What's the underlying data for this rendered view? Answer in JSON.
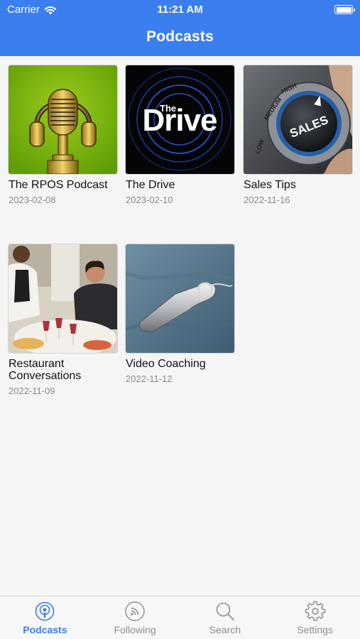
{
  "status_bar": {
    "carrier": "Carrier",
    "time": "11:21 AM"
  },
  "nav": {
    "title": "Podcasts"
  },
  "podcasts": [
    {
      "title": "The RPOS Podcast",
      "date": "2023-02-08"
    },
    {
      "title": "The Drive",
      "date": "2023-02-10"
    },
    {
      "title": "Sales Tips",
      "date": "2022-11-16"
    },
    {
      "title": "Restaurant\nConversations",
      "date": "2022-11-09"
    },
    {
      "title": "Video Coaching",
      "date": "2022-11-12"
    }
  ],
  "artwork_text": {
    "drive_small": "The",
    "drive_big": "Drive",
    "knob_word": "SALES",
    "knob_scale": [
      "LOW",
      "MEDIUM",
      "HIGH"
    ]
  },
  "tabs": [
    {
      "label": "Podcasts",
      "icon": "podcast-icon",
      "active": true
    },
    {
      "label": "Following",
      "icon": "feed-icon",
      "active": false
    },
    {
      "label": "Search",
      "icon": "search-icon",
      "active": false
    },
    {
      "label": "Settings",
      "icon": "gear-icon",
      "active": false
    }
  ],
  "colors": {
    "accent": "#3b7ef0",
    "background": "#f5f5f5",
    "date_text": "#8b8b8b"
  }
}
